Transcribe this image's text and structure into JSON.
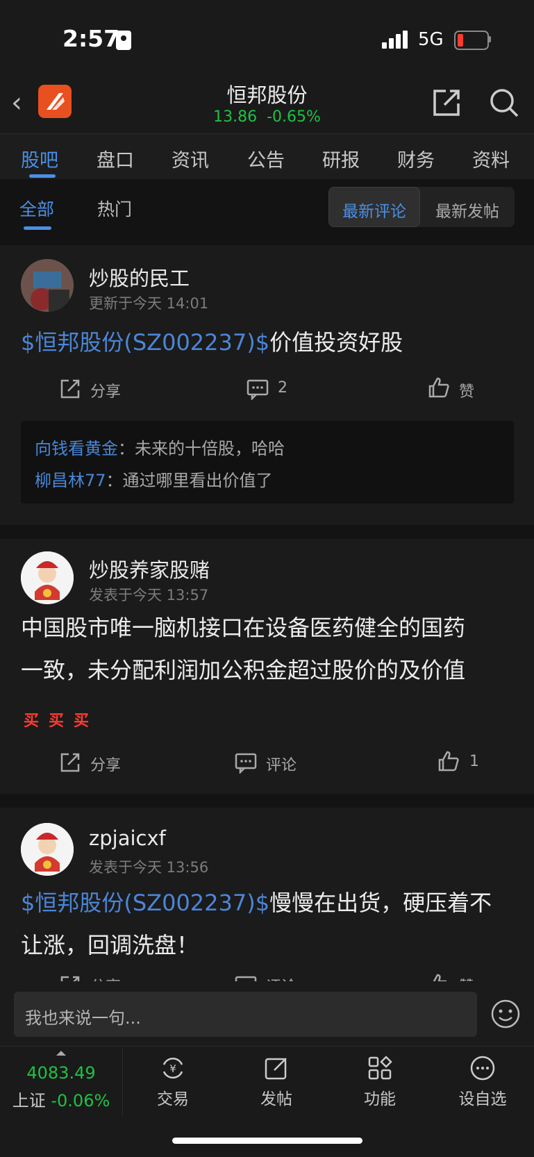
{
  "status_bar": {
    "time": "2:57",
    "network": "5G"
  },
  "header": {
    "title": "恒邦股份",
    "price": "13.86",
    "change": "-0.65%",
    "colors": {
      "up_green": "#1ec244",
      "accent": "#4a8fe6"
    }
  },
  "tabs": [
    "股吧",
    "盘口",
    "资讯",
    "公告",
    "研报",
    "财务",
    "资料"
  ],
  "subtabs": {
    "all": "全部",
    "hot": "热门",
    "latest_comment": "最新评论",
    "latest_post": "最新发帖"
  },
  "posts": [
    {
      "user": "炒股的民工",
      "time": "更新于今天 14:01",
      "link": "$恒邦股份(SZ002237)$",
      "text": "价值投资好股",
      "share": "分享",
      "comment": "2",
      "like": "赞",
      "comments": [
        {
          "name": "向钱看黄金",
          "sep": "：",
          "text": "未来的十倍股，哈哈"
        },
        {
          "name": "柳昌林77",
          "sep": "：",
          "text": "通过哪里看出价值了"
        }
      ]
    },
    {
      "user": "炒股养家股赌",
      "time": "发表于今天 13:57",
      "line1": "中国股市唯一脑机接口在设备医药健全的国药",
      "line2": "一致，未分配利润加公积金超过股价的及价值",
      "buy": [
        "买",
        "买",
        "买"
      ],
      "share": "分享",
      "comment": "评论",
      "like": "1"
    },
    {
      "user": "zpjaicxf",
      "time": "发表于今天 13:56",
      "link": "$恒邦股份(SZ002237)$",
      "text1": "慢慢在出货，硬压着不",
      "text2": "让涨，回调洗盘！",
      "share": "分享",
      "comment": "评论",
      "like": "赞"
    }
  ],
  "comment_input": {
    "placeholder": "我也来说一句..."
  },
  "bottom": {
    "index_value": "4083.49",
    "index_name": "上证",
    "index_change": "-0.06%",
    "nav": [
      "交易",
      "发帖",
      "功能",
      "设自选"
    ]
  }
}
